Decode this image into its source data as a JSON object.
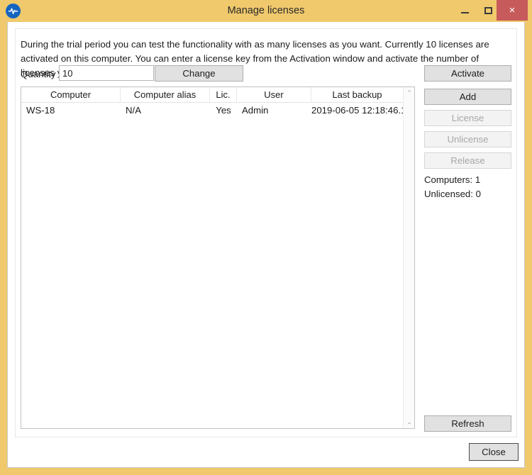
{
  "window": {
    "title": "Manage licenses",
    "app_icon": "waveform-icon",
    "accent_color": "#efc96c",
    "close_button_color": "#c75b5b",
    "controls": {
      "minimize": "minimize-icon",
      "maximize": "maximize-icon",
      "close": "×"
    }
  },
  "body": {
    "intro_text": "During the trial period you can test the functionality with as many licenses as you want. Currently 10 licenses are activated on this computer. You can enter a license key from the Activation window and activate the number of licenses you purchased.",
    "quantity": {
      "label": "Quantity",
      "value": "10",
      "placeholder": "",
      "change_label": "Change"
    }
  },
  "table": {
    "columns": [
      "Computer",
      "Computer alias",
      "Lic.",
      "User",
      "Last backup"
    ],
    "rows": [
      {
        "computer": "WS-18",
        "computer_alias": "N/A",
        "lic": "Yes",
        "user": "Admin",
        "last_backup": "2019-06-05 12:18:46.1"
      }
    ],
    "scrollbar": {
      "up_arrow": "⌃",
      "down_arrow": "⌄"
    }
  },
  "actions": {
    "activate": "Activate",
    "add": "Add",
    "license": "License",
    "unlicense": "Unlicense",
    "release": "Release",
    "refresh": "Refresh"
  },
  "status": {
    "computers": "Computers: 1",
    "unlicensed": "Unlicensed: 0"
  },
  "footer": {
    "close": "Close"
  }
}
